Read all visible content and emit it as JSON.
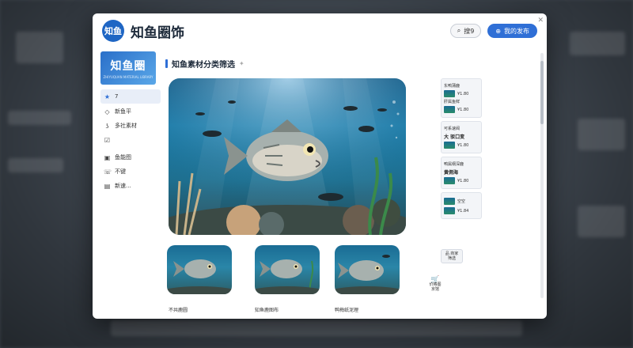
{
  "header": {
    "logo_text": "知鱼",
    "title": "知鱼圈饰",
    "search_label": "搜9",
    "primary_label": "我的发布"
  },
  "sidebar": {
    "banner_title": "知鱼圈",
    "banner_subtitle": "ZHIYUQUAN MATERIAL LIBRARY",
    "items": [
      {
        "label": "7",
        "icon": "star-icon"
      },
      {
        "label": "新鱼平",
        "icon": "diamond-icon"
      },
      {
        "label": "多社素材",
        "icon": "hook-icon"
      },
      {
        "label": "",
        "icon": "check-icon"
      },
      {
        "label": "鱼能图",
        "icon": "image-icon"
      },
      {
        "label": "不键",
        "icon": "phone-icon"
      },
      {
        "label": "新速...",
        "icon": "doc-icon"
      }
    ]
  },
  "main": {
    "section_title": "知鱼素材分类筛选",
    "section_sparkle": "✦",
    "thumbnails": [
      {
        "caption": "不共鹿圆"
      },
      {
        "caption": "知鱼鹿图布"
      },
      {
        "caption": "鸭梅纸泥理"
      }
    ],
    "filter_button": "品 商家筛选",
    "cart_button": "价格图 京馆"
  },
  "right_list": {
    "groups": [
      {
        "rows": [
          {
            "label": "东鸭蒲鹿",
            "price": ""
          },
          {
            "label": "",
            "price": "¥1.80"
          },
          {
            "label": "肝属鱼鲜",
            "price": ""
          },
          {
            "label": "",
            "price": "¥1.80"
          }
        ]
      },
      {
        "label": "可系速阀",
        "title": "大 驳口变",
        "price": "¥1.80"
      },
      {
        "label": "鸭属纲深鹿",
        "title": "黄佣海",
        "price": "¥1.80"
      },
      {
        "label": "空空",
        "price": "¥1.84"
      }
    ]
  },
  "colors": {
    "accent": "#2f6fd6",
    "title_text": "#1d2a3a",
    "ocean_deep": "#0d4f7a"
  },
  "icons": {
    "close": "close-icon",
    "search": "search-icon",
    "primary": "upload-icon"
  }
}
